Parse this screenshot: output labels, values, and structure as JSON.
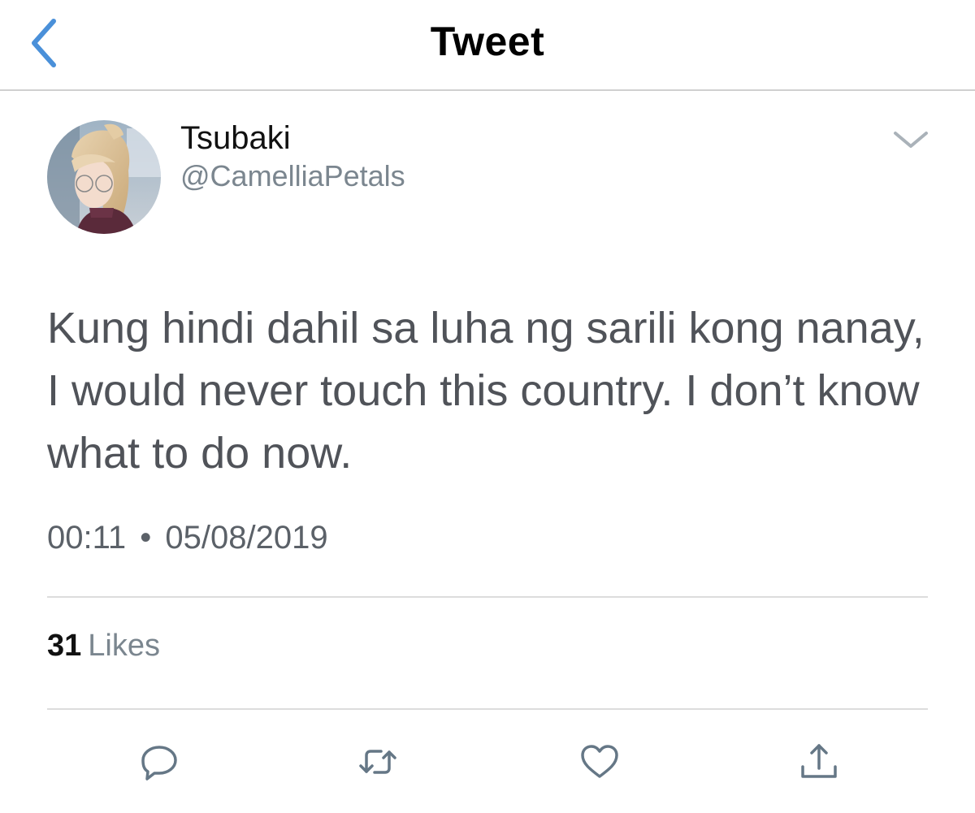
{
  "nav": {
    "title": "Tweet",
    "back_icon": "chevron-left-icon"
  },
  "tweet": {
    "author": {
      "name": "Tsubaki",
      "handle": "@CamelliaPetals"
    },
    "text": "Kung hindi dahil sa luha ng sarili kong nanay, I would never touch this country. I don’t know what to do now.",
    "time": "00:11",
    "separator": "•",
    "date": "05/08/2019",
    "likes_count": "31",
    "likes_label": "Likes"
  },
  "actions": [
    {
      "icon": "reply-icon"
    },
    {
      "icon": "retweet-icon"
    },
    {
      "icon": "heart-icon"
    },
    {
      "icon": "share-icon"
    }
  ],
  "colors": {
    "accent": "#4a90d9",
    "icon_gray": "#657786",
    "text_gray": "#505359",
    "divider": "#dcdcdc"
  }
}
